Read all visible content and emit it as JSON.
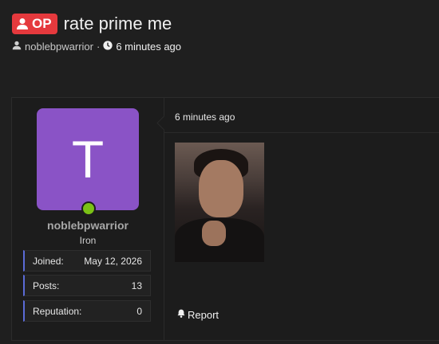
{
  "thread": {
    "badge": "OP",
    "title": "rate prime me",
    "author": "noblebpwarrior",
    "separator": "·",
    "time": "6 minutes ago"
  },
  "user": {
    "avatar_letter": "T",
    "avatar_color": "#8a53c6",
    "online_color": "#7bc116",
    "username": "noblebpwarrior",
    "rank": "Iron",
    "stats": [
      {
        "label": "Joined:",
        "value": "May 12, 2026"
      },
      {
        "label": "Posts:",
        "value": "13"
      },
      {
        "label": "Reputation:",
        "value": "0"
      }
    ]
  },
  "post": {
    "time": "6 minutes ago",
    "report_label": "Report"
  }
}
